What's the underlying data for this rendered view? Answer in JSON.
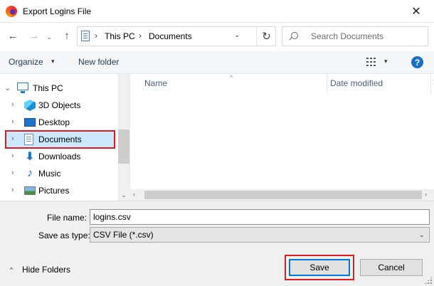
{
  "window": {
    "title": "Export Logins File",
    "close_glyph": "✕"
  },
  "nav": {
    "back": "←",
    "forward": "→",
    "recent": "⌄",
    "up": "↑"
  },
  "address": {
    "crumbs": [
      "This PC",
      "Documents"
    ],
    "separator": "›",
    "dropdown": "⌄",
    "refresh": "↻"
  },
  "search": {
    "placeholder": "Search Documents"
  },
  "toolbar": {
    "organize_label": "Organize",
    "caret": "▾",
    "new_folder_label": "New folder",
    "help": "?"
  },
  "sidebar": {
    "items": [
      {
        "label": "This PC",
        "icon": "computer-icon",
        "chevron": "⌄"
      },
      {
        "label": "3D Objects",
        "icon": "cube-icon",
        "chevron": "›"
      },
      {
        "label": "Desktop",
        "icon": "desktop-icon",
        "chevron": "›"
      },
      {
        "label": "Documents",
        "icon": "documents-icon",
        "chevron": "›",
        "selected": true
      },
      {
        "label": "Downloads",
        "icon": "download-arrow-icon",
        "chevron": "›"
      },
      {
        "label": "Music",
        "icon": "music-note-icon",
        "chevron": "›"
      },
      {
        "label": "Pictures",
        "icon": "pictures-icon",
        "chevron": "›"
      }
    ],
    "download_glyph": "⬇",
    "music_glyph": "♪",
    "scroll_down": "⌄"
  },
  "file_list": {
    "sort_arrow": "^",
    "columns": [
      "Name",
      "Date modified",
      "T"
    ]
  },
  "hscroll": {
    "left": "‹",
    "right": "›"
  },
  "form": {
    "filename_label": "File name:",
    "filename_value": "logins.csv",
    "savetype_label": "Save as type:",
    "savetype_value": "CSV File (*.csv)",
    "savetype_caret": "⌄"
  },
  "footer": {
    "hide_folders_caret": "^",
    "hide_folders_label": "Hide Folders",
    "save_label": "Save",
    "cancel_label": "Cancel"
  },
  "colors": {
    "selection": "#cce8ff",
    "highlight_box": "#e0191f",
    "accent": "#0078d7",
    "help": "#1a6fc4"
  }
}
